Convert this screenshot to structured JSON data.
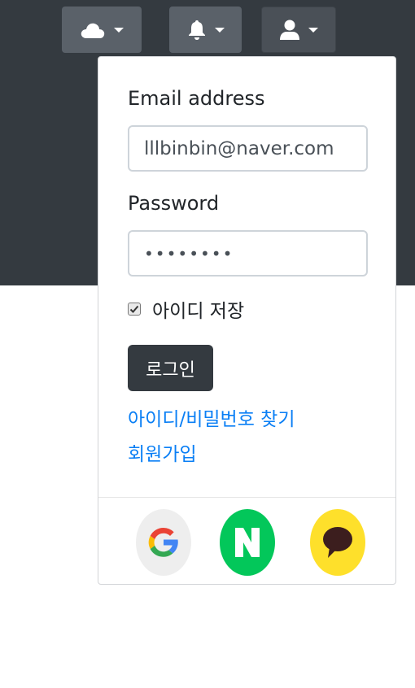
{
  "navbar": {
    "buttons": [
      {
        "icon": "cloud-icon"
      },
      {
        "icon": "bell-icon"
      },
      {
        "icon": "user-icon"
      }
    ]
  },
  "login": {
    "email_label": "Email address",
    "email_value": "lllbinbin@naver.com",
    "password_label": "Password",
    "password_value": "••••••••",
    "remember_label": "아이디 저장",
    "remember_checked": true,
    "login_button": "로그인",
    "find_link": "아이디/비밀번호 찾기",
    "signup_link": "회원가입"
  },
  "social": [
    {
      "name": "google-login",
      "icon": "google-icon",
      "color": "#eeeeee"
    },
    {
      "name": "naver-login",
      "icon": "naver-icon",
      "color": "#03c75a"
    },
    {
      "name": "kakao-login",
      "icon": "kakao-icon",
      "color": "#fee02b"
    }
  ]
}
